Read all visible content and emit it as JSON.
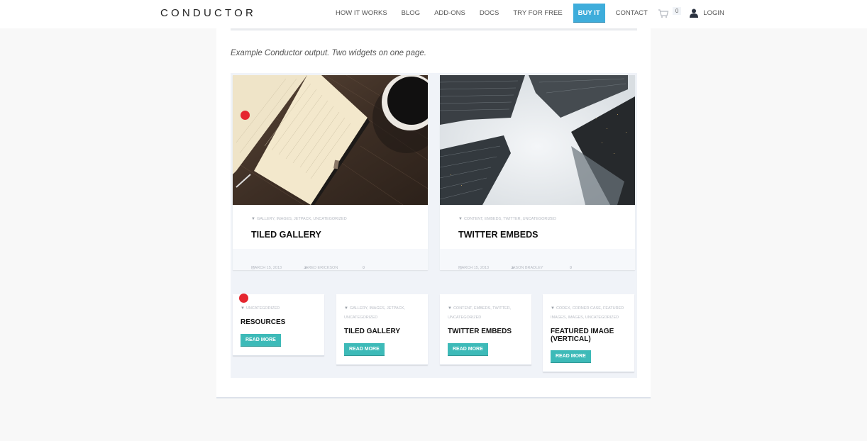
{
  "header": {
    "logo": "CONDUCTOR",
    "nav": [
      {
        "label": "HOW IT WORKS"
      },
      {
        "label": "BLOG"
      },
      {
        "label": "ADD-ONS"
      },
      {
        "label": "DOCS"
      },
      {
        "label": "TRY FOR FREE"
      },
      {
        "label": "BUY IT",
        "highlight_color": "#3eaddb"
      },
      {
        "label": "CONTACT"
      }
    ],
    "cart": {
      "icon": "cart-icon",
      "count": "0"
    },
    "login": {
      "icon": "user-icon",
      "label": "LOGIN"
    }
  },
  "main": {
    "intro": "Example Conductor output. Two widgets on one page.",
    "featured_posts": [
      {
        "image": "notebook-and-coffee-photo",
        "categories": "GALLERY, IMAGES, JETPACK, UNCATEGORIZED",
        "title": "TILED GALLERY",
        "date": "MARCH 15, 2013",
        "author": "JARED ERICKSON",
        "comments": "0"
      },
      {
        "image": "skyscrapers-photo",
        "categories": "CONTENT, EMBEDS, TWITTER, UNCATEGORIZED",
        "title": "TWITTER EMBEDS",
        "date": "MARCH 15, 2013",
        "author": "JASON BRADLEY",
        "comments": "0"
      }
    ],
    "grid_posts": [
      {
        "categories": "UNCATEGORIZED",
        "title": "RESOURCES",
        "button": "READ MORE"
      },
      {
        "categories": "GALLERY, IMAGES, JETPACK, UNCATEGORIZED",
        "title": "TILED GALLERY",
        "button": "READ MORE"
      },
      {
        "categories": "CONTENT, EMBEDS, TWITTER, UNCATEGORIZED",
        "title": "TWITTER EMBEDS",
        "button": "READ MORE"
      },
      {
        "categories": "CODEX, CORNER CASE, FEATURED IMAGES, IMAGES, UNCATEGORIZED",
        "title": "FEATURED IMAGE (VERTICAL)",
        "button": "READ MORE"
      }
    ],
    "accent_color": "#3dbab8",
    "marker_color": "#e5262f"
  }
}
